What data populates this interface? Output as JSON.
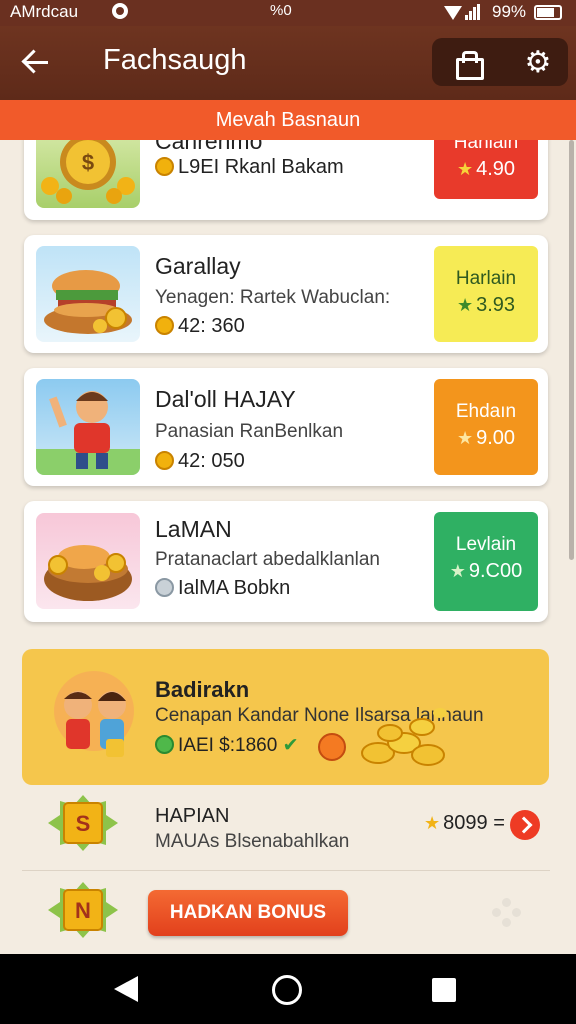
{
  "status_bar": {
    "carrier": "AMrdcau",
    "center": "%0",
    "battery": "99%"
  },
  "app_bar": {
    "title": "Fachsaugh"
  },
  "banner": {
    "text": "Mevah Basnaun"
  },
  "cards": [
    {
      "title": "Canrenmo",
      "desc": "",
      "meta": "L9EI Rkanl Bakam",
      "badge_label": "Hanlaih",
      "badge_value": "4.90",
      "badge_color": "#e83a2b",
      "badge_text_color": "#ffffff",
      "coin": "gold"
    },
    {
      "title": "Garallay",
      "desc": "Yenagen: Rartek Wabuclan:",
      "meta": "42: 360",
      "badge_label": "Harlain",
      "badge_value": "3.93",
      "badge_color": "#f6eb55",
      "badge_text_color": "#2f5a20",
      "coin": "gold"
    },
    {
      "title": "Dal'oll HAJAY",
      "desc": "Panasian RanBenlkan",
      "meta": "42: 050",
      "badge_label": "Ehdaın",
      "badge_value": "9.00",
      "badge_color": "#f3951c",
      "badge_text_color": "#ffffff",
      "coin": "gold"
    },
    {
      "title": "LaMAN",
      "desc": "Pratanaclart abedalklanlan",
      "meta": "IalMA Bobkn",
      "badge_label": "Levlain",
      "badge_value": "9.C00",
      "badge_color": "#2fb063",
      "badge_text_color": "#ffffff",
      "coin": "grey"
    }
  ],
  "promo": {
    "title": "Badirakn",
    "desc": "Cenapan Kandar None Ilsarsa lannaun",
    "meta": "IAEI $:1860"
  },
  "list_items": [
    {
      "title": "HAPIAN",
      "desc": "MAUAs Blsenabahlkan",
      "value": "8099 ="
    }
  ],
  "bonus_row": {
    "button_label": "HADKAN BONUS"
  },
  "colors": {
    "app_bar": "#6a3020",
    "banner": "#f15a2a",
    "background": "#f3ece1",
    "accent": "#ee3b24"
  }
}
